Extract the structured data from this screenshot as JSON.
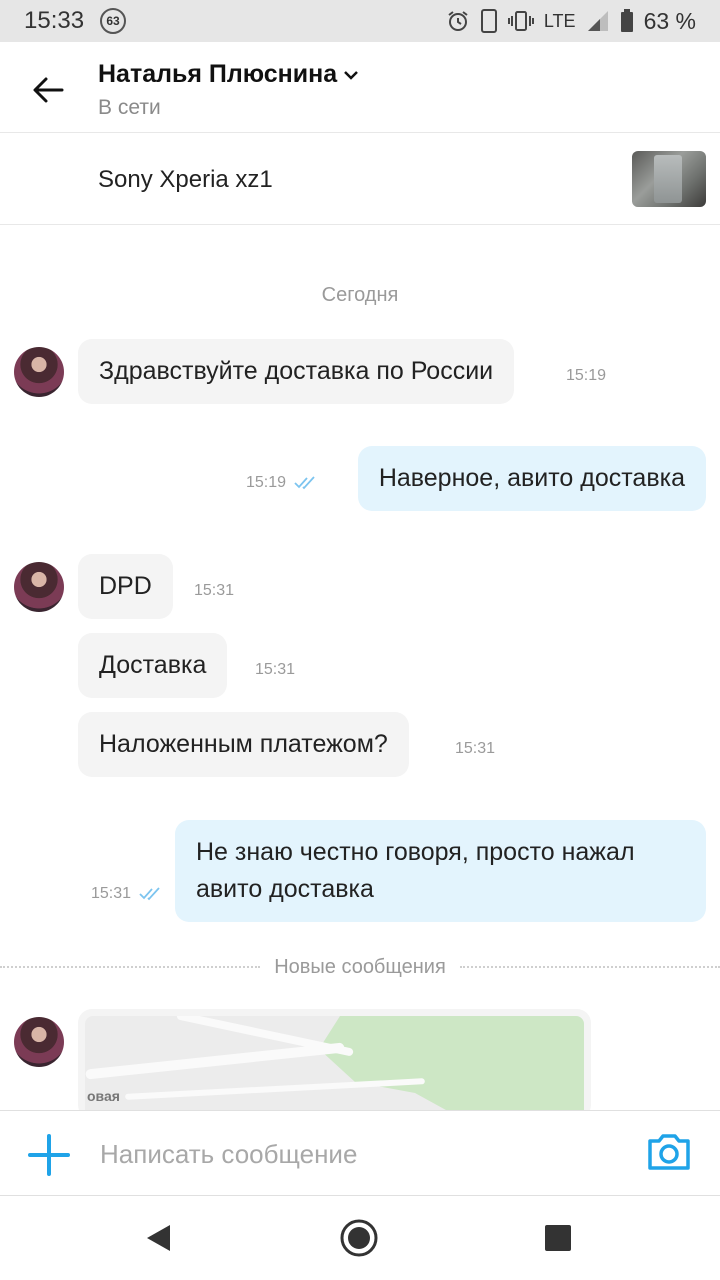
{
  "status_bar": {
    "time": "15:33",
    "notification_count": "63",
    "network": "LTE",
    "battery": "63 %"
  },
  "header": {
    "contact_name": "Наталья Плюснина",
    "contact_status": "В сети",
    "icons": [
      "back-arrow-icon",
      "chevron-down-icon"
    ]
  },
  "item": {
    "title": "Sony Xperia xz1"
  },
  "chat": {
    "day_label": "Сегодня",
    "messages": [
      {
        "direction": "in",
        "text": "Здравствуйте доставка по России",
        "time": "15:19"
      },
      {
        "direction": "out",
        "text": "Наверное, авито доставка",
        "time": "15:19",
        "read": true
      },
      {
        "direction": "in",
        "text": "DPD",
        "time": "15:31"
      },
      {
        "direction": "in",
        "text": "Доставка",
        "time": "15:31"
      },
      {
        "direction": "in",
        "text": "Наложенным платежом?",
        "time": "15:31"
      },
      {
        "direction": "out",
        "text_line1": "Не знаю честно говоря, просто нажал",
        "text_line2": "авито доставка",
        "time": "15:31",
        "read": true
      }
    ],
    "new_messages_label": "Новые сообщения",
    "map_label": "овая"
  },
  "composer": {
    "placeholder": "Написать сообщение",
    "attach_icon": "plus-icon",
    "camera_icon": "camera-icon"
  },
  "colors": {
    "accent": "#1fa3e8",
    "outgoing_bubble": "#e3f4fd",
    "incoming_bubble": "#f4f4f4",
    "read_check": "#7cc4ef"
  }
}
